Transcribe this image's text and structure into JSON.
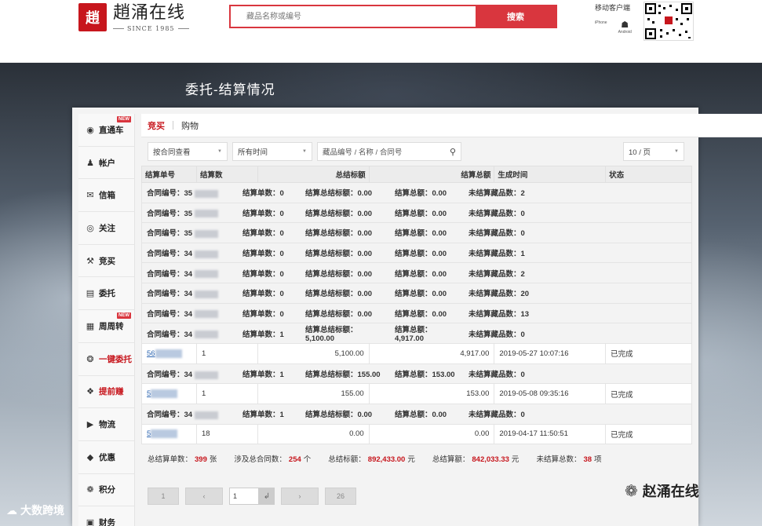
{
  "header": {
    "logo_glyph": "趙",
    "brand_name": "趙涌在线",
    "brand_since": "SINCE 1985",
    "search_placeholder": "藏品名称或编号",
    "search_button": "搜索",
    "mobile_title_partial": "移动客户端",
    "app_iphone": "iPhone",
    "app_android": "Android"
  },
  "page": {
    "heading": "委托-结算情况"
  },
  "sidebar": {
    "items": [
      {
        "label": "直通车",
        "icon": "play-circle-icon",
        "badge": "NEW"
      },
      {
        "label": "帐户",
        "icon": "user-icon"
      },
      {
        "label": "信箱",
        "icon": "mail-icon"
      },
      {
        "label": "关注",
        "icon": "eye-icon"
      },
      {
        "label": "竞买",
        "icon": "gavel-icon"
      },
      {
        "label": "委托",
        "icon": "tray-icon"
      },
      {
        "label": "周周转",
        "icon": "calendar-icon",
        "badge": "NEW"
      },
      {
        "label": "一键委托",
        "icon": "medal-icon"
      },
      {
        "label": "提前赚",
        "icon": "coins-icon"
      },
      {
        "label": "物流",
        "icon": "truck-icon"
      },
      {
        "label": "优惠",
        "icon": "tag-icon"
      },
      {
        "label": "积分",
        "icon": "points-icon"
      },
      {
        "label": "财务",
        "icon": "finance-icon"
      }
    ]
  },
  "tabs": [
    "竞买",
    "购物"
  ],
  "filters": {
    "contract_select": "按合同查看",
    "time_select": "所有时间",
    "search_placeholder": "藏品编号 / 名称 / 合同号",
    "page_size": "10 / 页"
  },
  "table": {
    "headers": [
      "结算单号",
      "结算数",
      "总结标额",
      "结算总额",
      "生成时间",
      "状态"
    ],
    "labels": {
      "contract": "合同编号：",
      "settle_count": "结算单数：",
      "settle_hammer": "结算总结标额：",
      "settle_total": "结算总额：",
      "unsettled": "未结算藏品数："
    },
    "groups": [
      {
        "contract": "35",
        "count": "0",
        "hammer": "0.00",
        "total": "0.00",
        "unsettled": "2"
      },
      {
        "contract": "35",
        "count": "0",
        "hammer": "0.00",
        "total": "0.00",
        "unsettled": "0"
      },
      {
        "contract": "35",
        "count": "0",
        "hammer": "0.00",
        "total": "0.00",
        "unsettled": "0"
      },
      {
        "contract": "34",
        "count": "0",
        "hammer": "0.00",
        "total": "0.00",
        "unsettled": "1"
      },
      {
        "contract": "34",
        "count": "0",
        "hammer": "0.00",
        "total": "0.00",
        "unsettled": "2"
      },
      {
        "contract": "34",
        "count": "0",
        "hammer": "0.00",
        "total": "0.00",
        "unsettled": "20"
      },
      {
        "contract": "34",
        "count": "0",
        "hammer": "0.00",
        "total": "0.00",
        "unsettled": "13"
      },
      {
        "contract": "34",
        "count": "1",
        "hammer": "5,100.00",
        "total": "4,917.00",
        "unsettled": "0",
        "detail": {
          "no": "56",
          "count": "1",
          "hammer": "5,100.00",
          "total": "4,917.00",
          "time": "2019-05-27 10:07:16",
          "status": "已完成"
        }
      },
      {
        "contract": "34",
        "count": "1",
        "hammer": "155.00",
        "total": "153.00",
        "unsettled": "0",
        "detail": {
          "no": "5",
          "count": "1",
          "hammer": "155.00",
          "total": "153.00",
          "time": "2019-05-08 09:35:16",
          "status": "已完成"
        }
      },
      {
        "contract": "34",
        "count": "1",
        "hammer": "0.00",
        "total": "0.00",
        "unsettled": "0",
        "detail": {
          "no": "5",
          "count": "18",
          "hammer": "0.00",
          "total": "0.00",
          "time": "2019-04-17 11:50:51",
          "status": "已完成"
        }
      }
    ]
  },
  "summary": {
    "total_settle_label": "总结算单数：",
    "total_settle_value": "399",
    "total_settle_unit": "张",
    "contracts_label": "涉及总合同数：",
    "contracts_value": "254",
    "contracts_unit": "个",
    "hammer_label": "总结标额：",
    "hammer_value": "892,433.00",
    "hammer_unit": "元",
    "amount_label": "总结算额：",
    "amount_value": "842,033.33",
    "amount_unit": "元",
    "unsettled_label": "未结算总数：",
    "unsettled_value": "38",
    "unsettled_unit": "项"
  },
  "pager": {
    "first": "1",
    "prev": "‹",
    "current": "1",
    "go": "↲",
    "next": "›",
    "last": "26"
  },
  "watermarks": {
    "right": "赵涌在线",
    "left": "大数跨境"
  }
}
